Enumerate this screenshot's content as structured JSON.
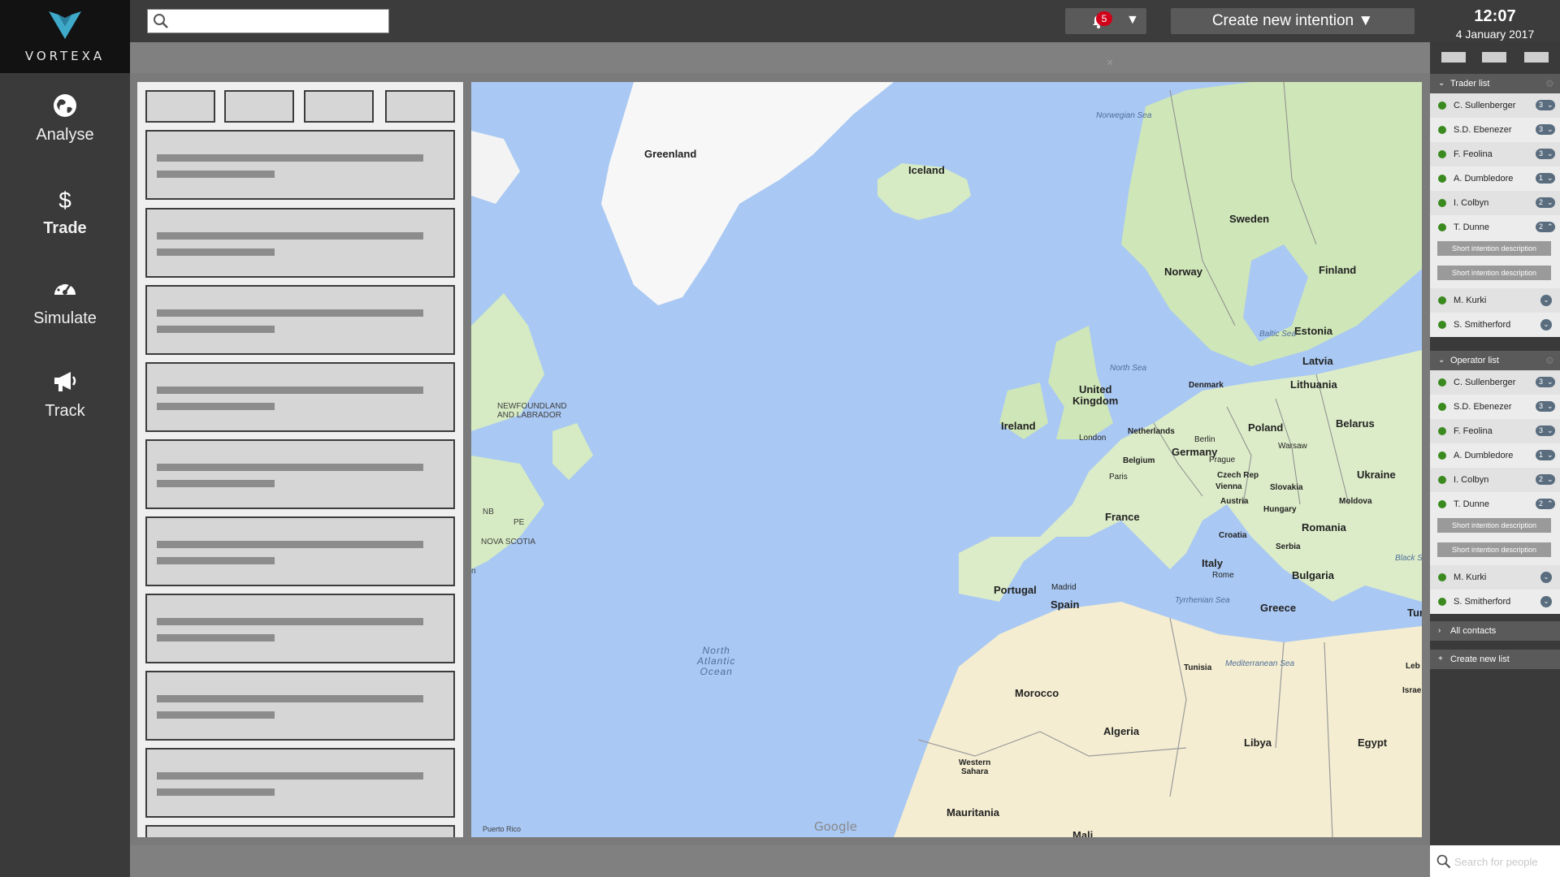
{
  "brand": {
    "name": "VORTEXA"
  },
  "nav": [
    {
      "label": "Analyse",
      "icon": "globe-icon"
    },
    {
      "label": "Trade",
      "icon": "dollar-icon"
    },
    {
      "label": "Simulate",
      "icon": "speedometer-icon"
    },
    {
      "label": "Track",
      "icon": "megaphone-icon"
    }
  ],
  "topbar": {
    "search_value": "",
    "notifications_count": "5",
    "dropdown_caret": "▼",
    "create_label": "Create new intention ▼"
  },
  "clock": {
    "time": "12:07",
    "date": "4 January 2017"
  },
  "map": {
    "labels": {
      "greenland": "Greenland",
      "iceland": "Iceland",
      "norwegian_sea": "Norwegian Sea",
      "sweden": "Sweden",
      "norway": "Norway",
      "finland": "Finland",
      "estonia": "Estonia",
      "latvia": "Latvia",
      "lithuania": "Lithuania",
      "baltic_sea": "Baltic Sea",
      "north_sea": "North Sea",
      "denmark": "Denmark",
      "uk": "United\nKingdom",
      "ireland": "Ireland",
      "london": "London",
      "netherlands": "Netherlands",
      "berlin": "Berlin",
      "poland": "Poland",
      "belarus": "Belarus",
      "warsaw": "Warsaw",
      "belgium": "Belgium",
      "germany": "Germany",
      "prague": "Prague",
      "paris": "Paris",
      "czech": "Czech Rep",
      "vienna": "Vienna",
      "slovakia": "Slovakia",
      "ukraine": "Ukraine",
      "austria": "Austria",
      "hungary": "Hungary",
      "moldova": "Moldova",
      "france": "France",
      "romania": "Romania",
      "croatia": "Croatia",
      "serbia": "Serbia",
      "black_sea": "Black S",
      "italy": "Italy",
      "rome": "Rome",
      "bulgaria": "Bulgaria",
      "portugal": "Portugal",
      "madrid": "Madrid",
      "spain": "Spain",
      "tyrrhenian": "Tyrrhenian Sea",
      "greece": "Greece",
      "tur": "Tur",
      "tunisia": "Tunisia",
      "mediterranean": "Mediterranean Sea",
      "leb": "Leb",
      "israel": "Israel",
      "morocco": "Morocco",
      "algeria": "Algeria",
      "libya": "Libya",
      "egypt": "Egypt",
      "western_sahara": "Western\nSahara",
      "mauritania": "Mauritania",
      "mali": "Mali",
      "north_atlantic": "North\nAtlantic\nOcean",
      "newfoundland": "NEWFOUNDLAND\nAND LABRADOR",
      "nb": "NB",
      "pe": "PE",
      "nova_scotia": "NOVA SCOTIA",
      "puerto_rico": "Puerto Rico",
      "edge_n": "n"
    },
    "attribution": "Google"
  },
  "right_panel": {
    "trader_list": {
      "title": "Trader list",
      "people": [
        {
          "name": "C. Sullenberger",
          "count": "3"
        },
        {
          "name": "S.D. Ebenezer",
          "count": "3"
        },
        {
          "name": "F. Feolina",
          "count": "3"
        },
        {
          "name": "A. Dumbledore",
          "count": "1"
        },
        {
          "name": "I. Colbyn",
          "count": "2"
        },
        {
          "name": "T. Dunne",
          "count": "2"
        }
      ],
      "intentions": [
        "Short intention description",
        "Short intention description"
      ],
      "others": [
        "M. Kurki",
        "S. Smitherford"
      ]
    },
    "operator_list": {
      "title": "Operator list",
      "people": [
        {
          "name": "C. Sullenberger",
          "count": "3"
        },
        {
          "name": "S.D. Ebenezer",
          "count": "3"
        },
        {
          "name": "F. Feolina",
          "count": "3"
        },
        {
          "name": "A. Dumbledore",
          "count": "1"
        },
        {
          "name": "I. Colbyn",
          "count": "2"
        },
        {
          "name": "T. Dunne",
          "count": "2"
        }
      ],
      "intentions": [
        "Short intention description",
        "Short intention description"
      ],
      "others": [
        "M. Kurki",
        "S. Smitherford"
      ]
    },
    "all_contacts": "All contacts",
    "create_new_list": "Create new list",
    "search_placeholder": "Search for people"
  }
}
